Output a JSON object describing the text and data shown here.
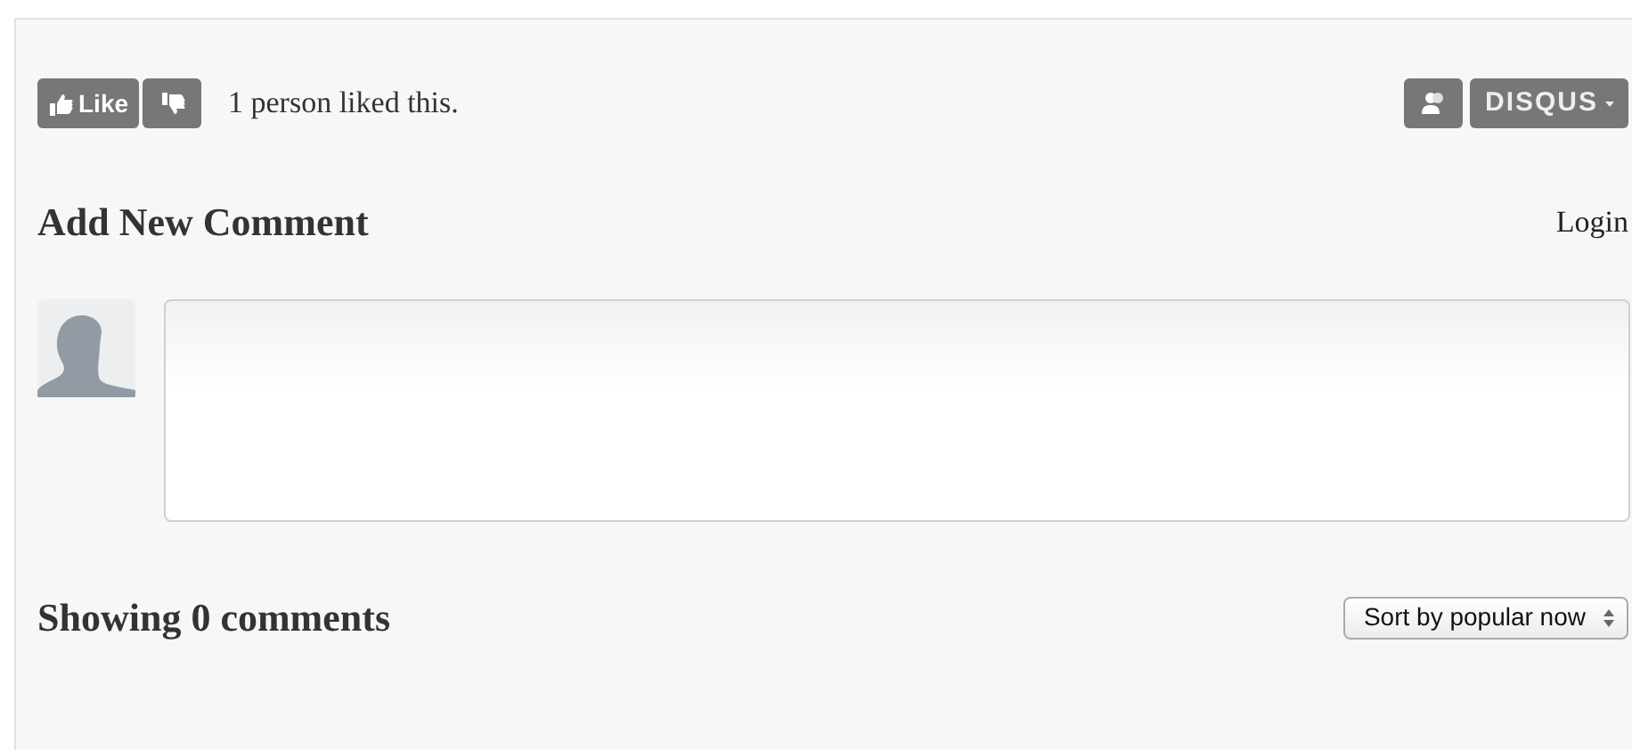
{
  "like_bar": {
    "like_label": "Like",
    "summary": "1 person liked this.",
    "brand": "DISQUS"
  },
  "compose": {
    "heading": "Add New Comment",
    "login": "Login"
  },
  "comments": {
    "count_label": "Showing 0 comments",
    "sort": "Sort by popular now"
  }
}
